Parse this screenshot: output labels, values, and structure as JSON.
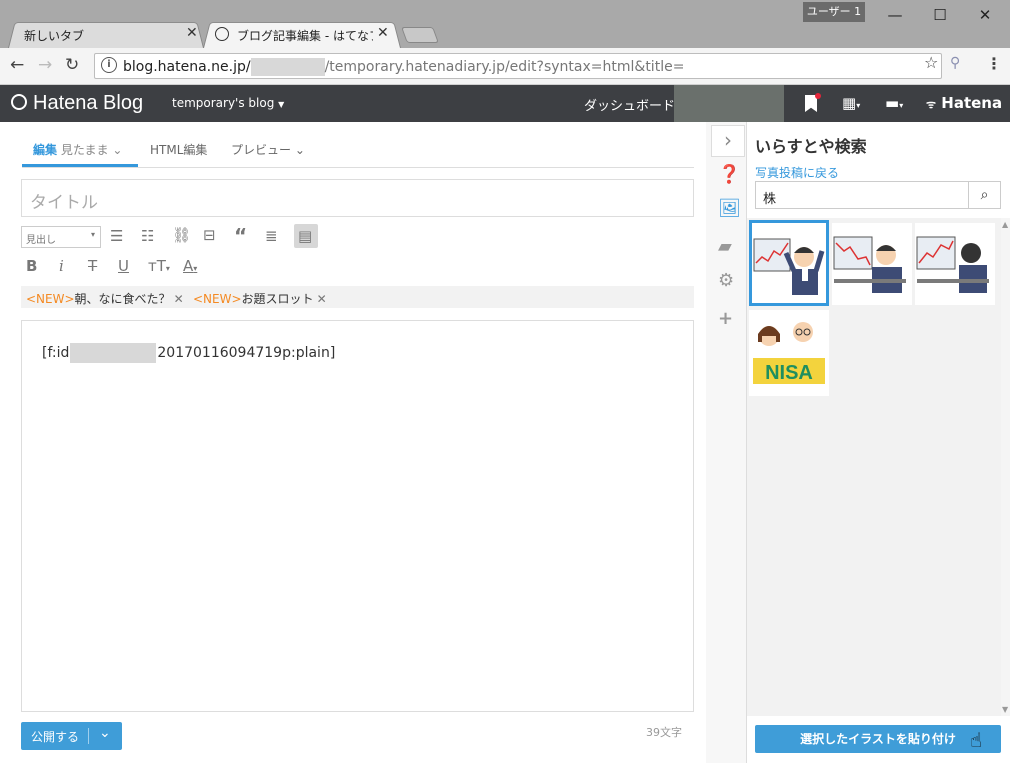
{
  "browser": {
    "user_chip": "ユーザー 1",
    "tabs": [
      {
        "title": "新しいタブ"
      },
      {
        "title": "ブログ記事編集 - はてなブロ"
      }
    ],
    "url_host": "blog.hatena.ne.jp/",
    "url_rest": "/temporary.hatenadiary.jp/edit?syntax=html&title="
  },
  "header": {
    "logo": "Hatena Blog",
    "blog_name": "temporary's blog",
    "dashboard": "ダッシュボード",
    "brand": "Hatena"
  },
  "editor": {
    "tabs": [
      {
        "label": "編集",
        "sub": "見たまま"
      },
      {
        "label": "HTML編集"
      },
      {
        "label": "プレビュー"
      }
    ],
    "title_placeholder": "タイトル",
    "heading_select": "見出し",
    "new_tag": "<NEW>",
    "topics": [
      "朝、なに食べた？",
      "お題スロット"
    ],
    "body_prefix": "[f:id",
    "body_suffix": "20170116094719p:plain]",
    "publish_label": "公開する",
    "char_count": "39文字"
  },
  "panel": {
    "title": "いらすとや検索",
    "back_link": "写真投稿に戻る",
    "search_value": "株",
    "paste_button": "選択したイラストを貼り付け",
    "nisa_label": "NISA"
  },
  "colors": {
    "accent": "#3598dc",
    "header_bg": "#3d3f43",
    "new_tag": "#f48a23"
  }
}
